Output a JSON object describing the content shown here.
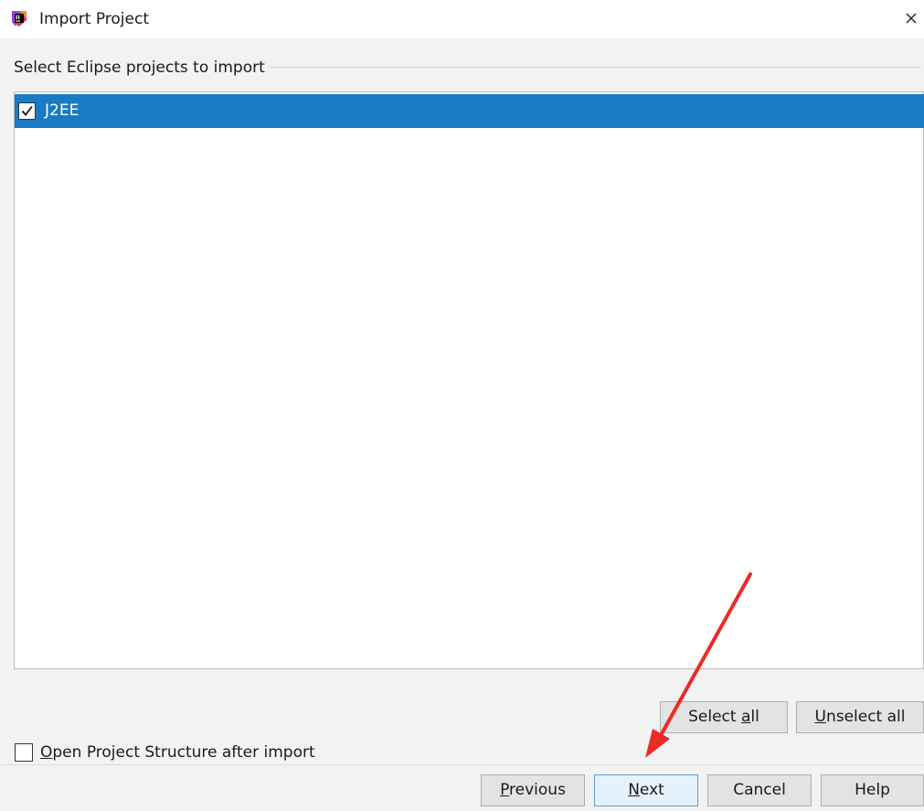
{
  "window": {
    "title": "Import Project",
    "icon": "intellij-idea-icon",
    "close_icon": "close-icon"
  },
  "section": {
    "label": "Select Eclipse projects to import"
  },
  "projects": [
    {
      "name": "J2EE",
      "checked": true,
      "selected": true
    }
  ],
  "selection_buttons": {
    "select_all": {
      "label": "Select all",
      "mnemonic_before": "Select ",
      "mnemonic_char": "a",
      "mnemonic_after": "ll"
    },
    "unselect_all": {
      "label": "Unselect all",
      "mnemonic_before": "",
      "mnemonic_char": "U",
      "mnemonic_after": "nselect all"
    }
  },
  "option": {
    "checked": false,
    "label": "Open Project Structure after import",
    "mnemonic_char": "O",
    "mnemonic_after": "pen Project Structure after import"
  },
  "footer_buttons": {
    "previous": {
      "label": "Previous",
      "mnemonic_char": "P",
      "mnemonic_after": "revious"
    },
    "next": {
      "label": "Next",
      "mnemonic_char": "N",
      "mnemonic_after": "ext"
    },
    "cancel": {
      "label": "Cancel"
    },
    "help": {
      "label": "Help"
    }
  },
  "colors": {
    "selection": "#1a7bc4",
    "dialog_bg": "#f2f2f2",
    "default_button_border": "#5b9bd5",
    "annotation_arrow": "#ee2b24"
  },
  "annotation": {
    "type": "arrow",
    "points_to": "next-button"
  }
}
